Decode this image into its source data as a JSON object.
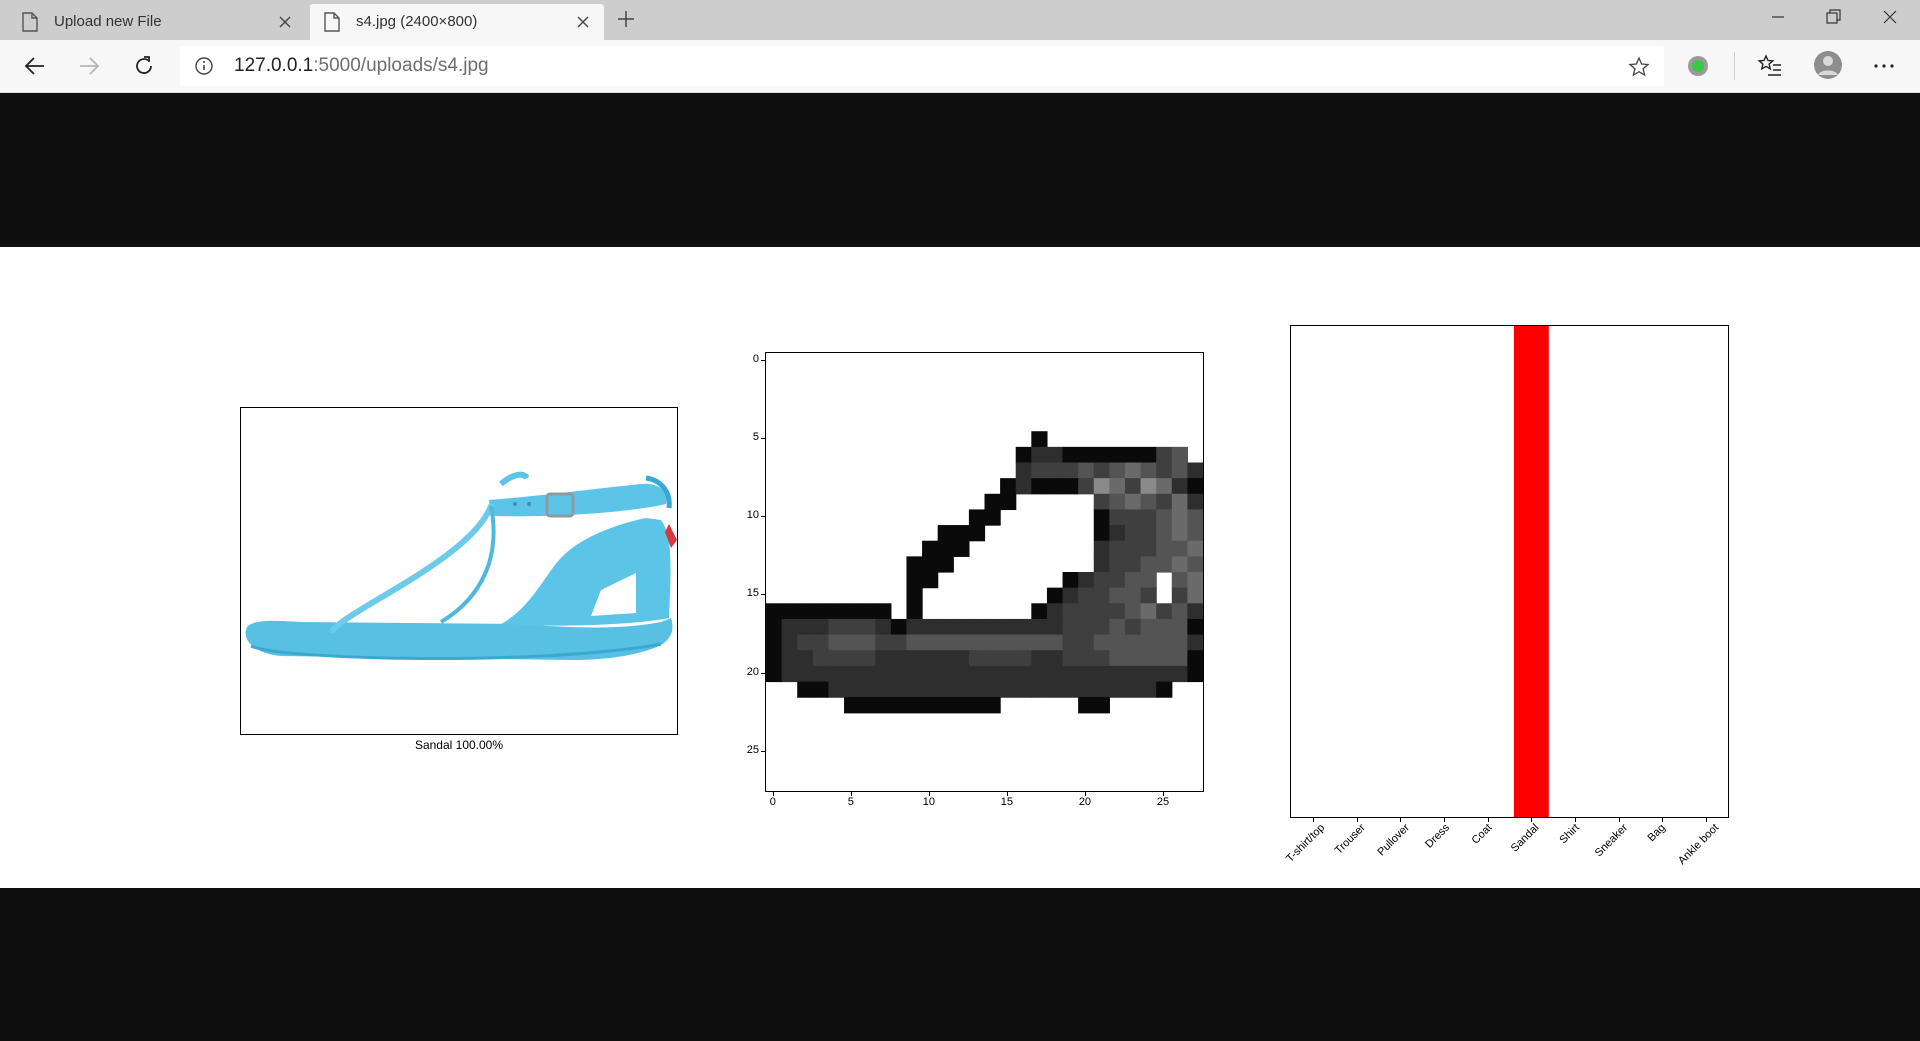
{
  "browser": {
    "tabs": [
      {
        "label": "Upload new File",
        "active": false
      },
      {
        "label": "s4.jpg (2400×800)",
        "active": true
      }
    ],
    "url": {
      "host": "127.0.0.1",
      "rest": ":5000/uploads/s4.jpg"
    }
  },
  "photo": {
    "caption": "Sandal 100.00%",
    "colors": {
      "sandal": "#5cc4e6",
      "sandal_dark": "#3aa9d1",
      "tag": "#d9363e"
    }
  },
  "pixel_plot": {
    "y_ticks": [
      "0",
      "5",
      "10",
      "15",
      "20",
      "25"
    ],
    "x_ticks": [
      "0",
      "5",
      "10",
      "15",
      "20",
      "25"
    ],
    "rows": [
      "############################",
      "############################",
      "############################",
      "############################",
      "############################",
      "#################H##########",
      "################HGGHHHHHHFE#",
      "################GFFFEFEDEFEG",
      "###############HGHHHFCDFCDGH",
      "##############HH#####FEDEFDG",
      "#############HH######HFFFEDE",
      "###########HHH#######HGFFEDE",
      "##########HHH########GFFFEED",
      "#########HHH#########GFFEEDE",
      "#########HH########HGFFEE#ED",
      "#########H########HGFFEEF#FD",
      "HHHHHHHH#H#######HGFFFFEDFEG",
      "HGGGFFFGHGGGGGGGGGGFFFEFEEEH",
      "HGFFEEEFFEEEEEEEEEEFFEEEEEEG",
      "HGGFFFFGGGGGGFFFFGGFFFEEEEEH",
      "HGGGGGGGGGGGGGGGGGGGGGGGGGGH",
      "##HHGGGGGGGGGGGGGGGGGGGGGH##",
      "#####HHHHHHHHHH#####HH######",
      "############################",
      "############################",
      "############################",
      "############################",
      "############################"
    ],
    "palette": {
      "#": "#ffffff",
      "H": "#0a0a0a",
      "G": "#2e2e2e",
      "F": "#3f3f3f",
      "E": "#545454",
      "D": "#6a6a6a",
      "C": "#8a8a8a"
    }
  },
  "chart_data": {
    "type": "bar",
    "categories": [
      "T-shirt/top",
      "Trouser",
      "Pullover",
      "Dress",
      "Coat",
      "Sandal",
      "Shirt",
      "Sneaker",
      "Bag",
      "Ankle boot"
    ],
    "values": [
      0,
      0,
      0,
      0,
      0,
      1.0,
      0,
      0,
      0,
      0
    ],
    "ylim": [
      0,
      1
    ],
    "bar_color": "#ff0000",
    "grid": false
  }
}
